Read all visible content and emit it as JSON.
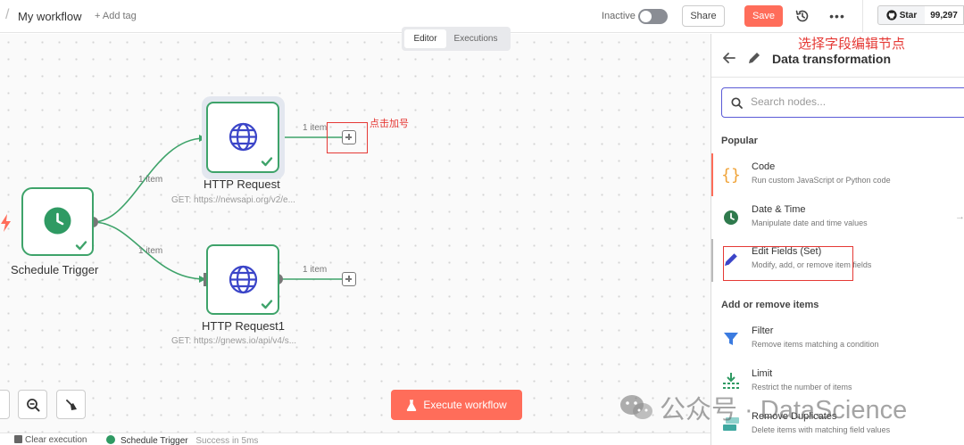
{
  "header": {
    "workflow_name": "My workflow",
    "add_tag": "+ Add tag",
    "status_label": "Inactive",
    "share_label": "Share",
    "save_label": "Save",
    "more_label": "•••",
    "github_star_label": "Star",
    "github_star_count": "99,297"
  },
  "tabs": [
    {
      "label": "Editor",
      "active": true
    },
    {
      "label": "Executions",
      "active": false
    }
  ],
  "canvas": {
    "nodes": [
      {
        "id": "schedule",
        "label": "Schedule Trigger",
        "icon": "clock-icon",
        "status": "success"
      },
      {
        "id": "http1",
        "label": "HTTP Request",
        "subtitle": "GET: https://newsapi.org/v2/e...",
        "icon": "globe-icon",
        "status": "success"
      },
      {
        "id": "http2",
        "label": "HTTP Request1",
        "subtitle": "GET: https://gnews.io/api/v4/s...",
        "icon": "globe-icon",
        "status": "success"
      }
    ],
    "edges": [
      {
        "from": "schedule",
        "to": "http1",
        "label": "1 item"
      },
      {
        "from": "schedule",
        "to": "http2",
        "label": "1 item"
      },
      {
        "from": "http1",
        "to": "add",
        "label": "1 item"
      },
      {
        "from": "http2",
        "to": "add",
        "label": "1 item"
      }
    ],
    "annotation_plus": "点击加号",
    "execute_label": "Execute workflow"
  },
  "bottom_bar": {
    "clear_execution": "Clear execution",
    "log_node": "Schedule Trigger",
    "log_status": "Success in 5ms"
  },
  "panel": {
    "annotation": "选择字段编辑节点",
    "title": "Data transformation",
    "search_placeholder": "Search nodes...",
    "sections": [
      {
        "title": "Popular",
        "items": [
          {
            "title": "Code",
            "description": "Run custom JavaScript or Python code",
            "icon": "code-braces-icon"
          },
          {
            "title": "Date & Time",
            "description": "Manipulate date and time values",
            "icon": "clock-icon"
          },
          {
            "title": "Edit Fields (Set)",
            "description": "Modify, add, or remove item fields",
            "icon": "pen-icon"
          }
        ]
      },
      {
        "title": "Add or remove items",
        "items": [
          {
            "title": "Filter",
            "description": "Remove items matching a condition",
            "icon": "filter-icon"
          },
          {
            "title": "Limit",
            "description": "Restrict the number of items",
            "icon": "limit-icon"
          },
          {
            "title": "Remove Duplicates",
            "description": "Delete items with matching field values",
            "icon": "dedupe-icon"
          }
        ]
      }
    ]
  },
  "watermark": "公众号 · DataScience",
  "colors": {
    "accent": "#ff6d5a",
    "success": "#3ea36a",
    "globe": "#3b45c8",
    "annotation": "#e53935"
  }
}
